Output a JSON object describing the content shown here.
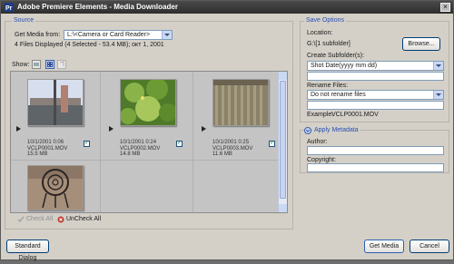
{
  "window": {
    "title": "Adobe Premiere Elements - Media Downloader"
  },
  "source": {
    "group_title": "Source",
    "get_media_label": "Get Media from:",
    "get_media_value": "L:\\<Camera or Card Reader>",
    "status": "4 Files Displayed (4 Selected - 53.4 MB); окт 1, 2001",
    "show_label": "Show:"
  },
  "files": [
    {
      "date": "10/1/2001 0:06",
      "name": "VCLP0001.MOV",
      "size": "15.5 MB",
      "checked": true
    },
    {
      "date": "10/1/2001 0:24",
      "name": "VCLP0002.MOV",
      "size": "14.8 MB",
      "checked": true
    },
    {
      "date": "10/1/2001 0:25",
      "name": "VCLP0003.MOV",
      "size": "11.6 MB",
      "checked": true
    },
    {
      "date": "",
      "name": "",
      "size": "",
      "checked": false
    }
  ],
  "actions": {
    "check_all": "Check All",
    "uncheck_all": "UnCheck All"
  },
  "save_options": {
    "group_title": "Save Options",
    "location_label": "Location:",
    "location_value": "G:\\[1 subfolder]",
    "browse": "Browse...",
    "create_subfolders_label": "Create Subfolder(s):",
    "create_subfolders_value": "Shot Date(yyyy mm dd)",
    "rename_label": "Rename Files:",
    "rename_value": "Do not rename files",
    "example_label": "Example:",
    "example_value": "VCLP0001.MOV"
  },
  "metadata": {
    "toggle_label": "Apply Metadata",
    "author_label": "Author:",
    "copyright_label": "Copyright:"
  },
  "footer": {
    "standard_dialog": "Standard Dialog",
    "get_media": "Get Media",
    "cancel": "Cancel"
  }
}
